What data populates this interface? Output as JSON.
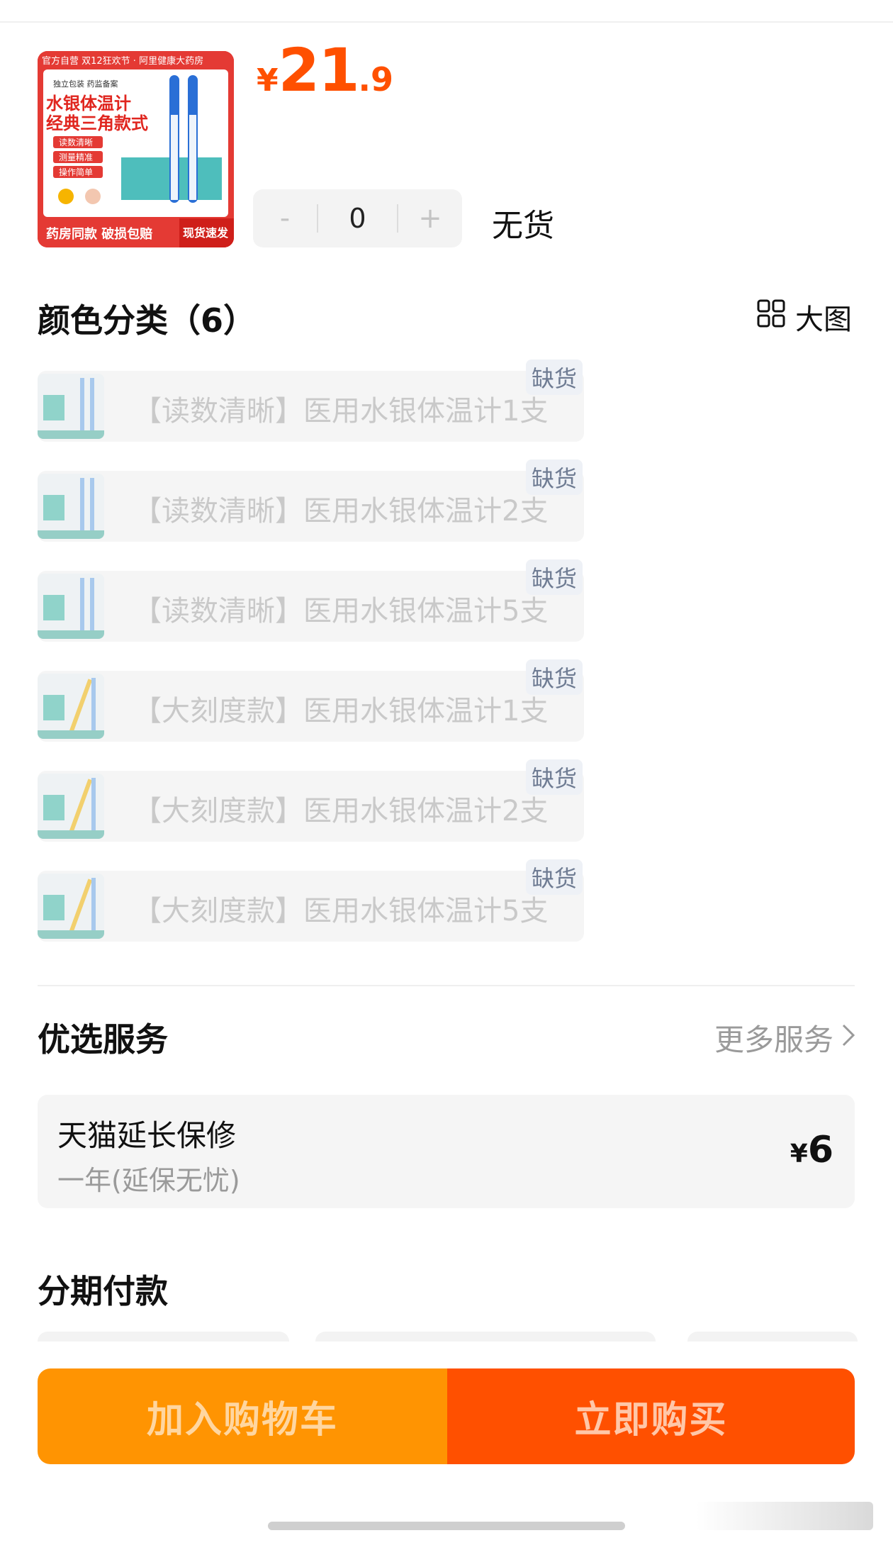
{
  "product": {
    "thumbnail_text": {
      "top_banner": "官方自营 双12狂欢节 · 阿里健康大药房",
      "tags": "独立包装 药监备案",
      "title_line1": "水银体温计",
      "title_line2": "经典三角款式",
      "features": [
        "读数清晰",
        "测量精准",
        "操作简单"
      ],
      "footer": "药房同款 破损包赔",
      "footer_badge": "现货速发"
    },
    "price_currency": "¥",
    "price_int": "21",
    "price_dec": ".9",
    "quantity": {
      "minus": "-",
      "value": "0",
      "plus": "+"
    },
    "stock_status": "无货"
  },
  "variants": {
    "title": "颜色分类（6）",
    "view_toggle_label": "大图",
    "items": [
      {
        "label": "【读数清晰】医用水银体温计1支",
        "badge": "缺货"
      },
      {
        "label": "【读数清晰】医用水银体温计2支",
        "badge": "缺货"
      },
      {
        "label": "【读数清晰】医用水银体温计5支",
        "badge": "缺货"
      },
      {
        "label": "【大刻度款】医用水银体温计1支",
        "badge": "缺货"
      },
      {
        "label": "【大刻度款】医用水银体温计2支",
        "badge": "缺货"
      },
      {
        "label": "【大刻度款】医用水银体温计5支",
        "badge": "缺货"
      }
    ]
  },
  "services": {
    "title": "优选服务",
    "more_label": "更多服务",
    "item": {
      "name": "天猫延长保修",
      "desc": "一年(延保无忧)",
      "price_currency": "¥",
      "price": "6"
    }
  },
  "installments": {
    "title": "分期付款"
  },
  "actions": {
    "add_to_cart": "加入购物车",
    "buy_now": "立即购买"
  },
  "colors": {
    "accent": "#ff5000",
    "cart": "#ff9402",
    "badge_text": "#6f7c93"
  }
}
